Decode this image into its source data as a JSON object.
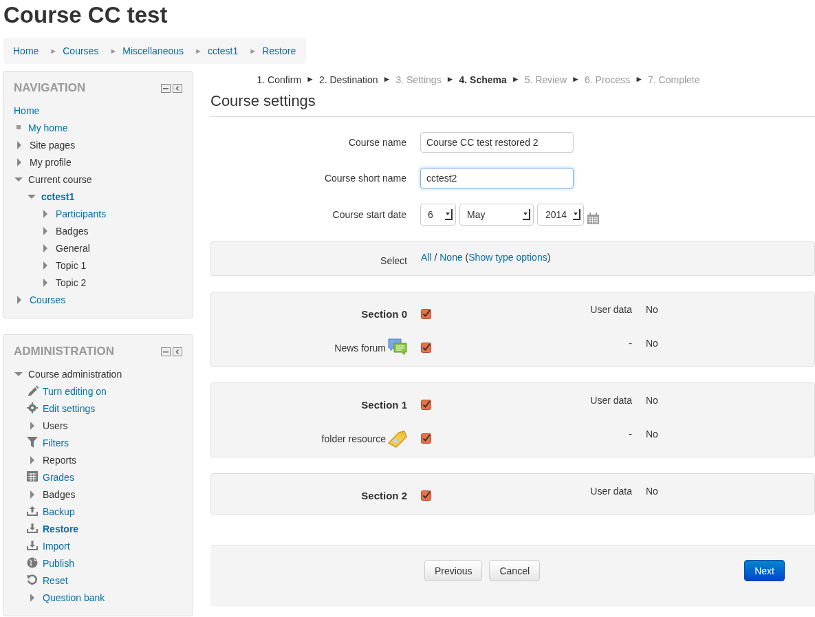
{
  "page_title": "Course CC test",
  "breadcrumb": {
    "separator": "►",
    "items": [
      "Home",
      "Courses",
      "Miscellaneous",
      "cctest1",
      "Restore"
    ]
  },
  "navigation": {
    "title": "NAVIGATION",
    "items": [
      {
        "label": "Home",
        "link": true,
        "kind": "plain",
        "current": false
      },
      {
        "label": "My home",
        "link": true,
        "kind": "leaf",
        "current": false
      },
      {
        "label": "Site pages",
        "link": false,
        "kind": "branch",
        "expanded": false,
        "current": false
      },
      {
        "label": "My profile",
        "link": false,
        "kind": "branch",
        "expanded": false,
        "current": false
      },
      {
        "label": "Current course",
        "link": false,
        "kind": "branch",
        "expanded": true,
        "current": false,
        "children": [
          {
            "label": "cctest1",
            "link": true,
            "kind": "branch",
            "expanded": true,
            "current": true,
            "children": [
              {
                "label": "Participants",
                "link": true,
                "kind": "branch",
                "expanded": false,
                "current": false
              },
              {
                "label": "Badges",
                "link": false,
                "kind": "branch",
                "expanded": false,
                "current": false
              },
              {
                "label": "General",
                "link": false,
                "kind": "branch",
                "expanded": false,
                "current": false
              },
              {
                "label": "Topic 1",
                "link": false,
                "kind": "branch",
                "expanded": false,
                "current": false
              },
              {
                "label": "Topic 2",
                "link": false,
                "kind": "branch",
                "expanded": false,
                "current": false
              }
            ]
          }
        ]
      },
      {
        "label": "Courses",
        "link": true,
        "kind": "branch",
        "expanded": false,
        "current": false
      }
    ]
  },
  "administration": {
    "title": "ADMINISTRATION",
    "items": [
      {
        "label": "Course administration",
        "link": false,
        "kind": "branch",
        "expanded": true,
        "current": false,
        "children": [
          {
            "label": "Turn editing on",
            "link": true,
            "kind": "edit",
            "current": false
          },
          {
            "label": "Edit settings",
            "link": true,
            "kind": "settings",
            "current": false
          },
          {
            "label": "Users",
            "link": false,
            "kind": "branch",
            "expanded": false,
            "current": false
          },
          {
            "label": "Filters",
            "link": true,
            "kind": "filter",
            "current": false
          },
          {
            "label": "Reports",
            "link": false,
            "kind": "branch",
            "expanded": false,
            "current": false
          },
          {
            "label": "Grades",
            "link": true,
            "kind": "grades",
            "current": false
          },
          {
            "label": "Badges",
            "link": false,
            "kind": "branch",
            "expanded": false,
            "current": false
          },
          {
            "label": "Backup",
            "link": true,
            "kind": "backup",
            "current": false
          },
          {
            "label": "Restore",
            "link": true,
            "kind": "restore",
            "current": true
          },
          {
            "label": "Import",
            "link": true,
            "kind": "import",
            "current": false
          },
          {
            "label": "Publish",
            "link": true,
            "kind": "publish",
            "current": false
          },
          {
            "label": "Reset",
            "link": true,
            "kind": "reset",
            "current": false
          },
          {
            "label": "Question bank",
            "link": true,
            "kind": "branch",
            "expanded": false,
            "current": false
          }
        ]
      }
    ]
  },
  "steps": {
    "separator": "►",
    "items": [
      {
        "label": "1. Confirm",
        "selected": false,
        "disabled": false
      },
      {
        "label": "2. Destination",
        "selected": false,
        "disabled": false
      },
      {
        "label": "3. Settings",
        "selected": false,
        "disabled": true
      },
      {
        "label": "4. Schema",
        "selected": true,
        "disabled": false
      },
      {
        "label": "5. Review",
        "selected": false,
        "disabled": true
      },
      {
        "label": "6. Process",
        "selected": false,
        "disabled": true
      },
      {
        "label": "7. Complete",
        "selected": false,
        "disabled": true
      }
    ]
  },
  "heading": "Course settings",
  "fields": [
    {
      "kind": "text",
      "label": "Course name",
      "value": "Course CC test restored 2",
      "focused": false
    },
    {
      "kind": "text",
      "label": "Course short name",
      "value": "cctest2",
      "focused": true
    },
    {
      "kind": "date",
      "label": "Course start date",
      "day": "6",
      "month": "May",
      "year": "2014"
    }
  ],
  "select_row": {
    "label": "Select",
    "parts": [
      {
        "kind": "link",
        "text": "All"
      },
      {
        "kind": "text",
        "text": " / "
      },
      {
        "kind": "link",
        "text": "None"
      },
      {
        "kind": "text",
        "text": " ("
      },
      {
        "kind": "link",
        "text": "Show type options"
      },
      {
        "kind": "text",
        "text": ")"
      }
    ]
  },
  "sections": [
    {
      "rows": [
        {
          "label": "Section 0",
          "kind": "section",
          "checked": true,
          "setting": "User data",
          "value": "No"
        },
        {
          "label": "News forum",
          "kind": "forum",
          "checked": true,
          "setting": "-",
          "value": "No"
        }
      ]
    },
    {
      "rows": [
        {
          "label": "Section 1",
          "kind": "section",
          "checked": true,
          "setting": "User data",
          "value": "No"
        },
        {
          "label": "folder resource",
          "kind": "resource",
          "checked": true,
          "setting": "-",
          "value": "No"
        }
      ]
    },
    {
      "rows": [
        {
          "label": "Section 2",
          "kind": "section",
          "checked": true,
          "setting": "User data",
          "value": "No"
        }
      ]
    }
  ],
  "buttons": [
    {
      "label": "Previous",
      "primary": false
    },
    {
      "label": "Cancel",
      "primary": false
    },
    {
      "label": "Next",
      "primary": true
    }
  ]
}
